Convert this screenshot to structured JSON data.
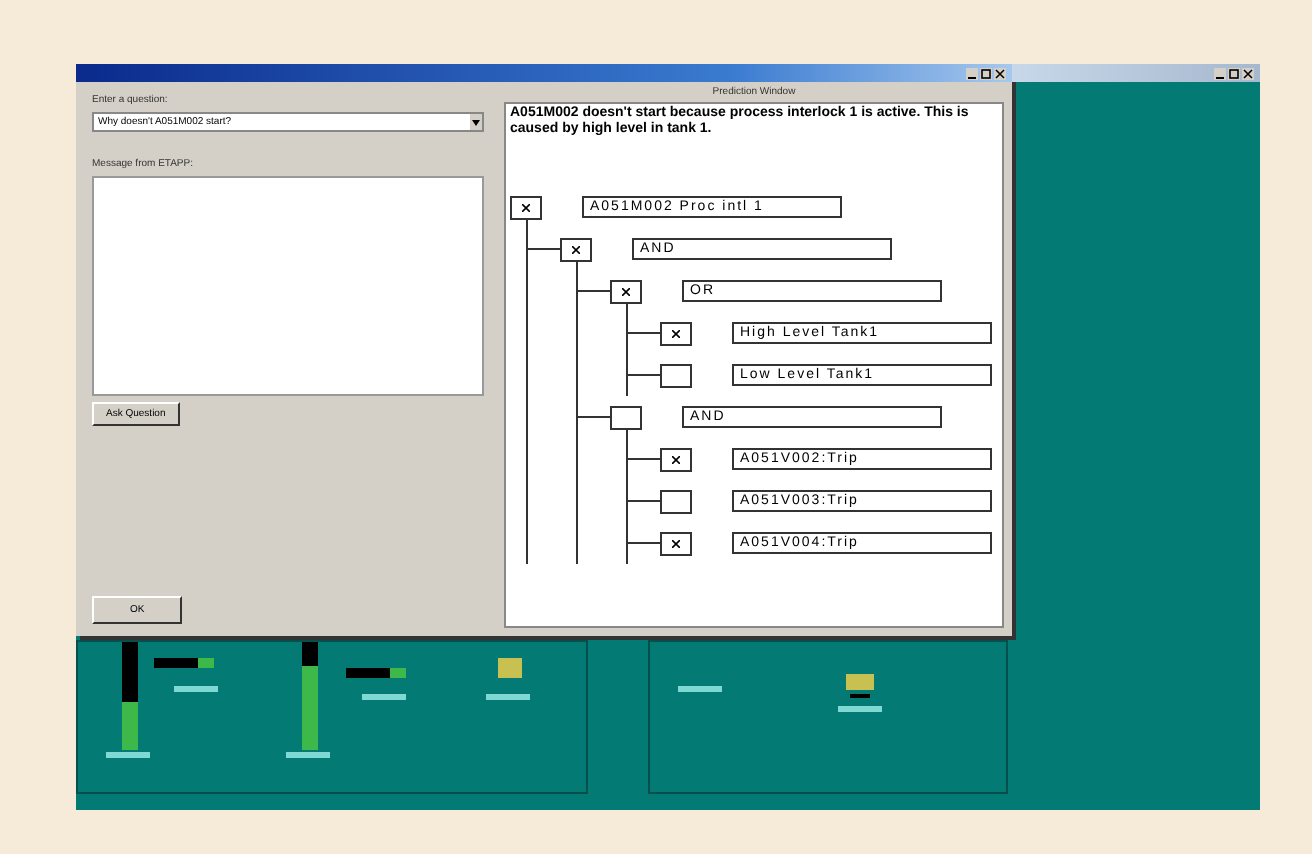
{
  "dialog": {
    "question_label": "Enter a question:",
    "question_value": "Why doesn't A051M002 start?",
    "message_label": "Message from ETAPP:",
    "ask_button": "Ask Question",
    "ok_button": "OK",
    "panel_title": "Prediction Window",
    "explanation": "A051M002 doesn't start because process interlock 1 is active. This is caused by high level in tank 1.",
    "tree": [
      {
        "label": "A051M002 Proc intl 1",
        "checked": true,
        "children": [
          {
            "label": "AND",
            "checked": true,
            "children": [
              {
                "label": "OR",
                "checked": true,
                "children": [
                  {
                    "label": "High Level Tank1",
                    "checked": true
                  },
                  {
                    "label": "Low Level Tank1",
                    "checked": false
                  }
                ]
              },
              {
                "label": "AND",
                "checked": false,
                "children": [
                  {
                    "label": "A051V002:Trip",
                    "checked": true
                  },
                  {
                    "label": "A051V003:Trip",
                    "checked": false
                  },
                  {
                    "label": "A051V004:Trip",
                    "checked": true
                  }
                ]
              }
            ]
          }
        ]
      }
    ]
  }
}
